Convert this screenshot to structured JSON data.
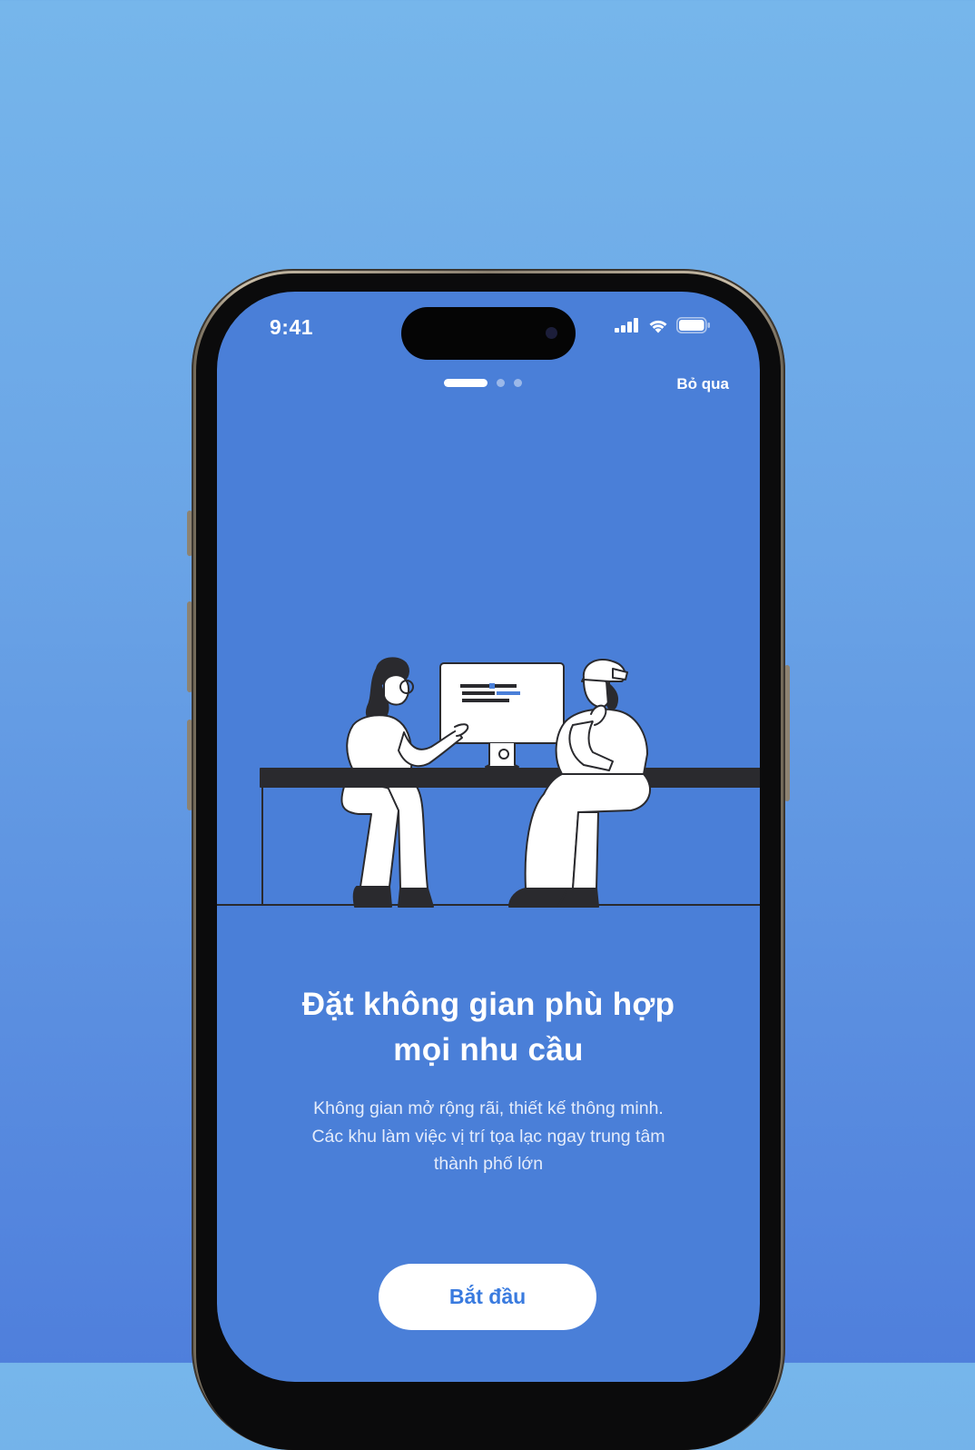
{
  "status_bar": {
    "time": "9:41"
  },
  "pagination": {
    "total": 3,
    "active_index": 0
  },
  "header": {
    "skip_label": "Bỏ qua"
  },
  "onboarding": {
    "title_line1": "Đặt không gian phù hợp",
    "title_line2": "mọi nhu cầu",
    "description_line1": "Không gian mở rộng rãi, thiết kế thông minh.",
    "description_line2": "Các khu làm việc vị trí tọa lạc ngay trung tâm",
    "description_line3": "thành phố lớn",
    "cta_label": "Bắt đầu"
  },
  "colors": {
    "background_top": "#76b6eb",
    "background_bottom": "#4f7fdc",
    "screen": "#4a7fd8",
    "accent": "#3a7bdf",
    "text": "#ffffff"
  },
  "icons": [
    "signal-icon",
    "wifi-icon",
    "battery-icon",
    "meeting-illustration"
  ]
}
